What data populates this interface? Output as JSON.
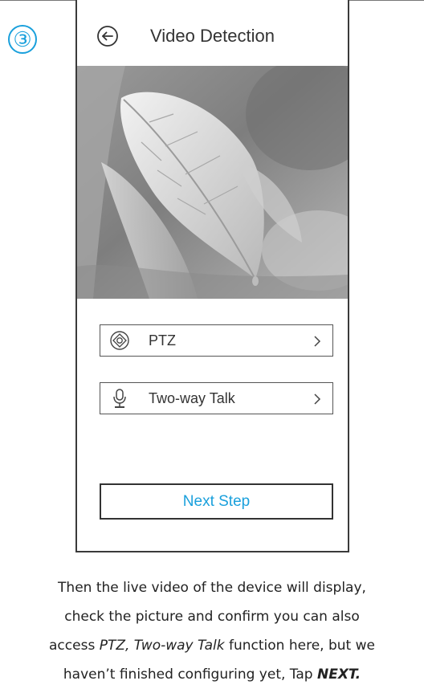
{
  "step_marker": "③",
  "header": {
    "title": "Video Detection",
    "back_icon": "arrow-left-circle-icon"
  },
  "video": {
    "content": "live-video-frame"
  },
  "menu": {
    "items": [
      {
        "icon": "ptz-joystick-icon",
        "label": "PTZ",
        "chevron": "chevron-right-icon"
      },
      {
        "icon": "microphone-icon",
        "label": "Two-way Talk",
        "chevron": "chevron-right-icon"
      }
    ]
  },
  "next_button": {
    "label": "Next Step"
  },
  "caption": {
    "line1": "Then the live video of the device will display,",
    "line2": "check the picture and confirm you can also",
    "line3_prefix": "access ",
    "line3_emphasis": "PTZ, Two-way Talk",
    "line3_suffix": " function here, but we",
    "line4_prefix": "haven’t finished configuring yet, Tap ",
    "line4_emphasis": "NEXT."
  },
  "colors": {
    "accent": "#1aa0dc",
    "frame": "#3a3a3a",
    "text": "#333333"
  }
}
